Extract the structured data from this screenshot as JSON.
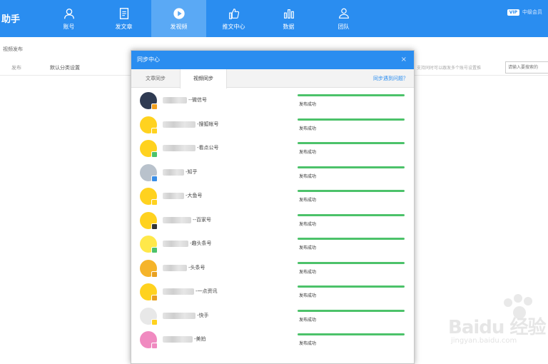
{
  "header": {
    "brand": "助手",
    "nav": [
      {
        "label": "账号",
        "icon": "user-icon"
      },
      {
        "label": "发文章",
        "icon": "document-icon"
      },
      {
        "label": "发视频",
        "icon": "play-icon",
        "active": true
      },
      {
        "label": "推文中心",
        "icon": "thumbs-up-icon"
      },
      {
        "label": "数据",
        "icon": "bar-chart-icon"
      },
      {
        "label": "团队",
        "icon": "team-icon"
      }
    ],
    "vip": "VIP",
    "user": "中级会员"
  },
  "page": {
    "breadcrumb": "视频发布",
    "publish": "发布",
    "category": "默认分类设置",
    "hint": "支持同时可以跟发多个账号设置推",
    "search_placeholder": "请输入要搜索的"
  },
  "modal": {
    "title": "同步中心",
    "close": "×",
    "tabs": [
      "文章同步",
      "视频同步"
    ],
    "help": "同步遇到问题？",
    "items": [
      {
        "account": "--微信号",
        "status": "发布成功",
        "avatar": "#2f3b52",
        "badge": "#f0a020",
        "blur": 34
      },
      {
        "account": "-搜狐帐号",
        "status": "发布成功",
        "avatar": "#ffd21f",
        "badge": "#ffd21f",
        "blur": 46
      },
      {
        "account": "-看点公号",
        "status": "发布成功",
        "avatar": "#ffd21f",
        "badge": "#4cc26a",
        "blur": 46
      },
      {
        "account": "-知乎",
        "status": "发布成功",
        "avatar": "#b9c2cc",
        "badge": "#3a8ee6",
        "blur": 30
      },
      {
        "account": "-大鱼号",
        "status": "发布成功",
        "avatar": "#ffd21f",
        "badge": "#ffd21f",
        "blur": 30
      },
      {
        "account": "--百家号",
        "status": "发布成功",
        "avatar": "#ffd21f",
        "badge": "#333333",
        "blur": 40
      },
      {
        "account": "-趣头条号",
        "status": "发布成功",
        "avatar": "#ffe84a",
        "badge": "#4cc26a",
        "blur": 36
      },
      {
        "account": "-头条号",
        "status": "发布成功",
        "avatar": "#f5b42a",
        "badge": "#e8a020",
        "blur": 34
      },
      {
        "account": "-一点资讯",
        "status": "发布成功",
        "avatar": "#ffd21f",
        "badge": "#e8a020",
        "blur": 44
      },
      {
        "account": "-快手",
        "status": "发布成功",
        "avatar": "#e8e8e8",
        "badge": "#ffd21f",
        "blur": 46
      },
      {
        "account": "-美拍",
        "status": "发布成功",
        "avatar": "#f08ac0",
        "badge": "#f08ac0",
        "blur": 42
      }
    ]
  },
  "watermark": {
    "brand": "Baidu 经验",
    "url": "jingyan.baidu.com"
  }
}
